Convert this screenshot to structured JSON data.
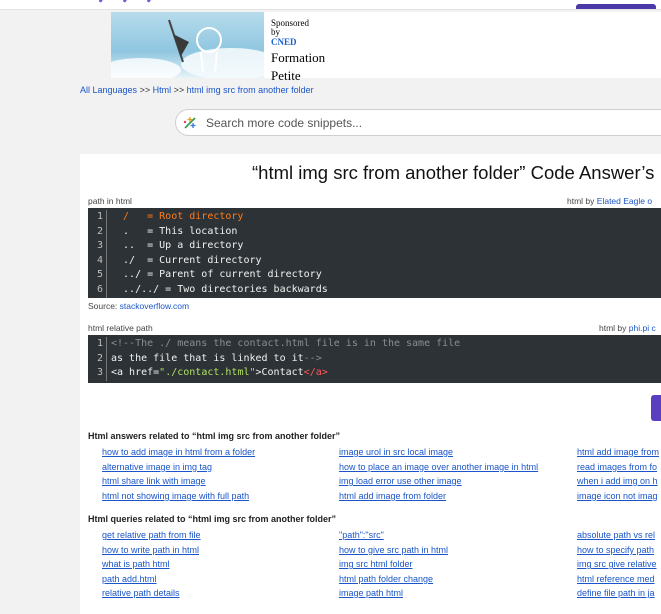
{
  "ad": {
    "sponsored": "Sponsored",
    "by": "by",
    "brand": "CNED",
    "title_line1": "Formation",
    "title_line2": "Petite"
  },
  "breadcrumb": {
    "root": "All Languages",
    "sep": ">>",
    "lang": "Html",
    "current": "html img src from another folder"
  },
  "search": {
    "placeholder": "Search more code snippets..."
  },
  "page_title": "“html img src from another folder” Code Answer’s",
  "snippet1": {
    "label": "path in html",
    "by_prefix": "html by",
    "author": "Elated Eagle o",
    "lines": [
      {
        "num": "1",
        "text": "  /   = Root directory",
        "style": "orange"
      },
      {
        "num": "2",
        "text": "  .   = This location",
        "style": "plain"
      },
      {
        "num": "3",
        "text": "  ..  = Up a directory",
        "style": "plain"
      },
      {
        "num": "4",
        "text": "  ./  = Current directory",
        "style": "plain"
      },
      {
        "num": "5",
        "text": "  ../ = Parent of current directory",
        "style": "plain"
      },
      {
        "num": "6",
        "text": "  ../../ = Two directories backwards",
        "style": "plain"
      }
    ],
    "source_prefix": "Source:",
    "source": "stackoverflow.com"
  },
  "snippet2": {
    "label": "html relative path",
    "by_prefix": "html by",
    "author": "phi.pi c",
    "line1": "<!--The ./ means the contact.html file is in the same file",
    "line2a": "as the file that is linked to it",
    "line2b": "-->",
    "line3_open": "<a href=",
    "line3_str": "\"./contact.html\"",
    "line3_gt": ">Contact",
    "line3_close": "</a>",
    "nums": [
      "1",
      "2",
      "3"
    ]
  },
  "answers": {
    "heading": "Html answers related to “html img src from another folder”",
    "col1": [
      "how to add image in html from a folder",
      "alternative image in img tag",
      "html share link with image",
      "html not showing image with full path"
    ],
    "col2": [
      "image urol in src local image",
      "how to place an image over another image in html",
      "img load error use other image",
      "html add image from folder"
    ],
    "col3": [
      "html add image from",
      "read images from fo",
      "when i add img on h",
      "image icon not imag"
    ]
  },
  "queries": {
    "heading": "Html queries related to “html img src from another folder”",
    "col1": [
      "get relative path from file",
      "how to write path in html",
      "what is path html",
      "path add.html",
      "relative path details"
    ],
    "col2": [
      "\"path\":\"src\"",
      "how to give src path in html",
      "img src html folder",
      "html path folder change",
      "image path html"
    ],
    "col3": [
      "absolute path vs rel",
      "how to specify path",
      "img src give relative",
      "html reference med",
      "define file path in ja"
    ]
  },
  "colors": {
    "link": "#1a55c9",
    "code_bg": "#2c3236",
    "accent": "#5a3fc0"
  }
}
